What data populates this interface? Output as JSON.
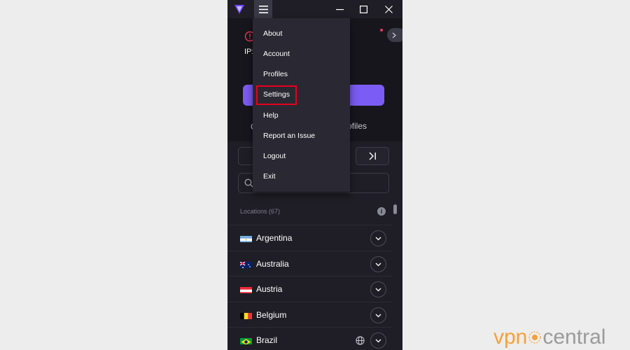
{
  "window": {
    "menu_icon": "hamburger-icon",
    "controls": [
      "minimize-icon",
      "maximize-icon",
      "close-icon"
    ]
  },
  "status": {
    "ip_label": "IP:"
  },
  "tabs": {
    "first_fragment": "C",
    "profiles_fragment": "ofiles"
  },
  "menu": {
    "items": [
      "About",
      "Account",
      "Profiles",
      "Settings",
      "Help",
      "Report an Issue",
      "Logout",
      "Exit"
    ],
    "highlighted": "Settings"
  },
  "locations": {
    "header": "Locations (67)",
    "info_glyph": "i",
    "countries": [
      {
        "name": "Argentina"
      },
      {
        "name": "Australia"
      },
      {
        "name": "Austria"
      },
      {
        "name": "Belgium"
      },
      {
        "name": "Brazil",
        "icon": "globe-icon"
      }
    ]
  },
  "watermark": {
    "vpn": "vpn",
    "central": "central"
  },
  "colors": {
    "accent": "#7b5cf5",
    "highlight_box": "#e8001c",
    "alert": "#f0365a",
    "app_bg": "#1f1e26",
    "menu_bg": "#2a2933"
  }
}
